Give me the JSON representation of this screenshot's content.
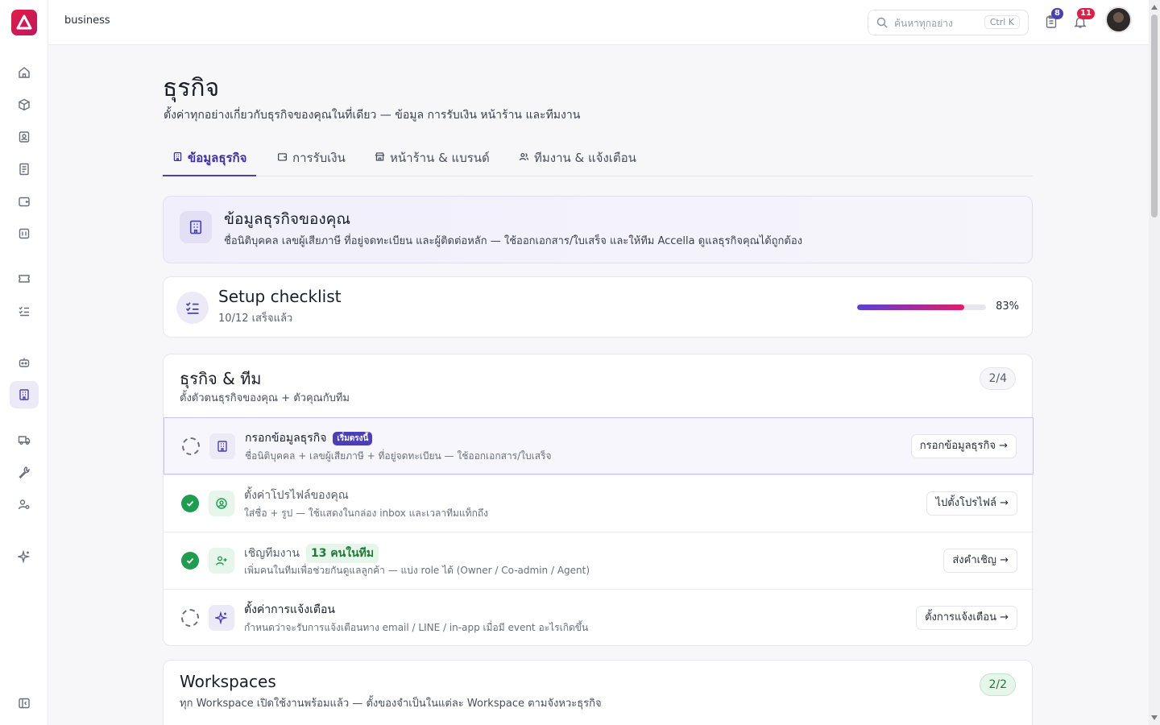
{
  "topbar": {
    "breadcrumb": "business",
    "search_placeholder": "ค้นหาทุกอย่าง",
    "search_shortcut": "Ctrl K",
    "tasks_badge": "8",
    "notifications_badge": "11"
  },
  "colors": {
    "accent": "#4b3fb8",
    "brand": "#e11d48",
    "success": "#1f9d4f"
  },
  "sidebar": {
    "icons": [
      "home-icon",
      "box-icon",
      "contacts-icon",
      "invoice-icon",
      "wallet-icon",
      "calendar-icon",
      "ticket-icon",
      "checklist-icon",
      "bot-icon",
      "building-icon",
      "truck-icon",
      "wrench-icon",
      "user-settings-icon",
      "sparkle-icon",
      "collapse-sidebar-icon"
    ],
    "active": "building-icon"
  },
  "page": {
    "title": "ธุรกิจ",
    "subtitle": "ตั้งค่าทุกอย่างเกี่ยวกับธุรกิจของคุณในที่เดียว — ข้อมูล การรับเงิน หน้าร้าน และทีมงาน"
  },
  "tabs": [
    {
      "label": "ข้อมูลธุรกิจ",
      "icon": "building-icon",
      "active": true
    },
    {
      "label": "การรับเงิน",
      "icon": "wallet-icon",
      "active": false
    },
    {
      "label": "หน้าร้าน & แบรนด์",
      "icon": "store-icon",
      "active": false
    },
    {
      "label": "ทีมงาน & แจ้งเตือน",
      "icon": "users-icon",
      "active": false
    }
  ],
  "intro": {
    "title": "ข้อมูลธุรกิจของคุณ",
    "description": "ชื่อนิติบุคคล เลขผู้เสียภาษี ที่อยู่จดทะเบียน และผู้ติดต่อหลัก — ใช้ออกเอกสาร/ใบเสร็จ และให้ทีม Accella ดูแลธุรกิจคุณได้ถูกต้อง"
  },
  "checklist": {
    "title": "Setup checklist",
    "summary": "10/12 เสร็จแล้ว",
    "percent_label": "83%",
    "progress": 0.83
  },
  "group": {
    "title": "ธุรกิจ & ทีม",
    "description": "ตั้งตัวตนธุรกิจของคุณ + ตัวคุณกับทีม",
    "count": "2/4",
    "items": [
      {
        "title": "กรอกข้อมูลธุรกิจ",
        "tag": "เริ่มตรงนี้",
        "description": "ชื่อนิติบุคคล + เลขผู้เสียภาษี + ที่อยู่จดทะเบียน — ใช้ออกเอกสาร/ใบเสร็จ",
        "button": "กรอกข้อมูลธุรกิจ →",
        "done": false
      },
      {
        "title": "ตั้งค่าโปรไฟล์ของคุณ",
        "description": "ใส่ชื่อ + รูป — ใช้แสดงในกล่อง inbox และเวลาทีมแท็กถึง",
        "button": "ไปตั้งโปรไฟล์ →",
        "done": true
      },
      {
        "title": "เชิญทีมงาน",
        "tag": "13 คนในทีม",
        "description": "เพิ่มคนในทีมเพื่อช่วยกันดูแลลูกค้า — แบ่ง role ได้ (Owner / Co-admin / Agent)",
        "button": "ส่งคำเชิญ →",
        "done": true
      },
      {
        "title": "ตั้งค่าการแจ้งเตือน",
        "description": "กำหนดว่าจะรับการแจ้งเตือนทาง email / LINE / in-app เมื่อมี event อะไรเกิดขึ้น",
        "button": "ตั้งการแจ้งเตือน →",
        "done": false
      }
    ]
  },
  "workspaces": {
    "title": "Workspaces",
    "description": "ทุก Workspace เปิดใช้งานพร้อมแล้ว — ตั้งของจำเป็นในแต่ละ Workspace ตามจังหวะธุรกิจ",
    "count": "2/2"
  }
}
